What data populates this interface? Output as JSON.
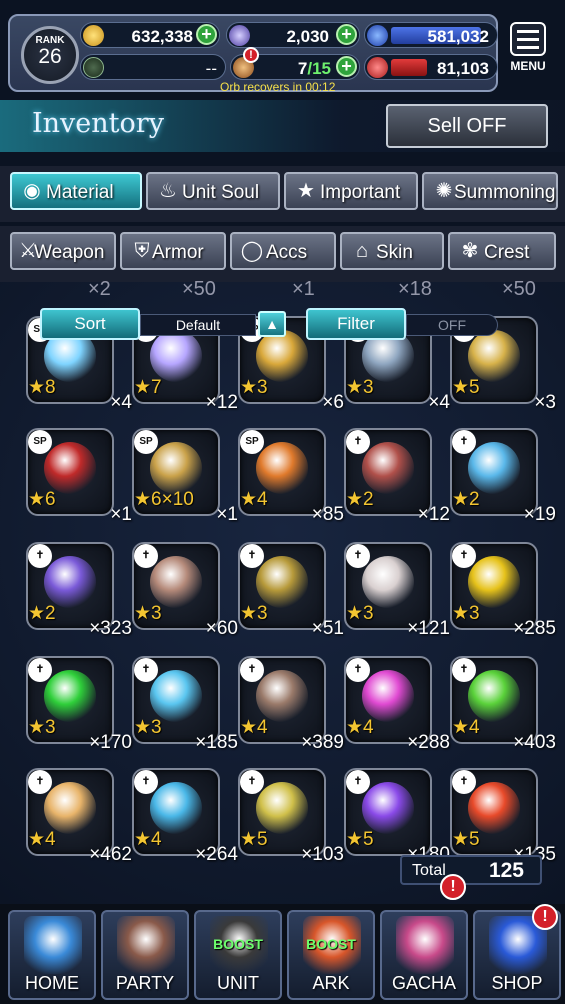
{
  "header": {
    "rank_label": "RANK",
    "rank_value": "26",
    "gil": "632,338",
    "lapis": "2,030",
    "blue_orb": "581,032",
    "green_value": "--",
    "energy_current": "7",
    "energy_max": "/15",
    "red_orb": "81,103",
    "orb_recovery": "Orb recovers in 00:12",
    "menu_label": "MENU"
  },
  "inventory": {
    "title": "Inventory",
    "sell_label": "Sell OFF"
  },
  "tabs_row1": [
    {
      "label": "Material",
      "icon": "bag-icon",
      "active": true
    },
    {
      "label": "Unit Soul",
      "icon": "flame-icon",
      "active": false
    },
    {
      "label": "Important",
      "icon": "star-icon",
      "active": false
    },
    {
      "label": "Summoning",
      "icon": "swirl-icon",
      "active": false
    }
  ],
  "tabs_row2": [
    {
      "label": "Weapon",
      "icon": "sword-icon"
    },
    {
      "label": "Armor",
      "icon": "armor-icon"
    },
    {
      "label": "Accs",
      "icon": "ring-icon"
    },
    {
      "label": "Skin",
      "icon": "hanger-icon"
    },
    {
      "label": "Crest",
      "icon": "crest-icon"
    }
  ],
  "sort": {
    "sort_label": "Sort",
    "sort_value": "Default",
    "filter_label": "Filter",
    "filter_value": "OFF"
  },
  "partial_counts": [
    "×2",
    "×50",
    "×1",
    "×18",
    "×50"
  ],
  "items": [
    {
      "stars": "★8",
      "qty": "×4",
      "tag": "SP",
      "color": "#7fd4ff"
    },
    {
      "stars": "★7",
      "qty": "×12",
      "tag": "SP",
      "color": "#b6a6ff"
    },
    {
      "stars": "★3",
      "qty": "×6",
      "tag": "SP",
      "color": "#d9a83a"
    },
    {
      "stars": "★3",
      "qty": "×4",
      "tag": "SP",
      "color": "#8fa6c0"
    },
    {
      "stars": "★5",
      "qty": "×3",
      "tag": "SP",
      "color": "#d7b24a"
    },
    {
      "stars": "★6",
      "qty": "×1",
      "tag": "SP",
      "color": "#c02a2a"
    },
    {
      "stars": "★6×10",
      "qty": "×1",
      "tag": "SP",
      "color": "#caa24a"
    },
    {
      "stars": "★4",
      "qty": "×85",
      "tag": "SP",
      "color": "#e07a2c"
    },
    {
      "stars": "★2",
      "qty": "×12",
      "tag": "✝",
      "color": "#b0504a"
    },
    {
      "stars": "★2",
      "qty": "×19",
      "tag": "✝",
      "color": "#5ab8ea"
    },
    {
      "stars": "★2",
      "qty": "×323",
      "tag": "✝",
      "color": "#7a5ad8"
    },
    {
      "stars": "★3",
      "qty": "×60",
      "tag": "✝",
      "color": "#b58a7a"
    },
    {
      "stars": "★3",
      "qty": "×51",
      "tag": "✝",
      "color": "#b79a3a"
    },
    {
      "stars": "★3",
      "qty": "×121",
      "tag": "✝",
      "color": "#d9d0d0"
    },
    {
      "stars": "★3",
      "qty": "×285",
      "tag": "✝",
      "color": "#e6c21a"
    },
    {
      "stars": "★3",
      "qty": "×170",
      "tag": "✝",
      "color": "#2fcf3a"
    },
    {
      "stars": "★3",
      "qty": "×185",
      "tag": "✝",
      "color": "#5ac6f0"
    },
    {
      "stars": "★4",
      "qty": "×389",
      "tag": "✝",
      "color": "#9a7a6a"
    },
    {
      "stars": "★4",
      "qty": "×288",
      "tag": "✝",
      "color": "#e04ad2"
    },
    {
      "stars": "★4",
      "qty": "×403",
      "tag": "✝",
      "color": "#5ad23a"
    },
    {
      "stars": "★4",
      "qty": "×462",
      "tag": "✝",
      "color": "#e8b46a"
    },
    {
      "stars": "★4",
      "qty": "×264",
      "tag": "✝",
      "color": "#4ab8e8"
    },
    {
      "stars": "★5",
      "qty": "×103",
      "tag": "✝",
      "color": "#d0c04a"
    },
    {
      "stars": "★5",
      "qty": "×180",
      "tag": "✝",
      "color": "#8a4ae8"
    },
    {
      "stars": "★5",
      "qty": "×135",
      "tag": "✝",
      "color": "#e84a2a"
    }
  ],
  "total": {
    "label": "Total",
    "value": "125"
  },
  "nav": [
    {
      "label": "HOME",
      "color": "#3a8ad8",
      "boost": ""
    },
    {
      "label": "PARTY",
      "color": "#8a5a4a",
      "boost": ""
    },
    {
      "label": "UNIT",
      "color": "#3a3a3a",
      "boost": "BOOST"
    },
    {
      "label": "ARK",
      "color": "#d8562a",
      "boost": "BOOST"
    },
    {
      "label": "GACHA",
      "color": "#c84a8a",
      "boost": ""
    },
    {
      "label": "SHOP",
      "color": "#2a5ad8",
      "boost": ""
    }
  ],
  "badges": {
    "gacha": "!",
    "shop": "!"
  }
}
